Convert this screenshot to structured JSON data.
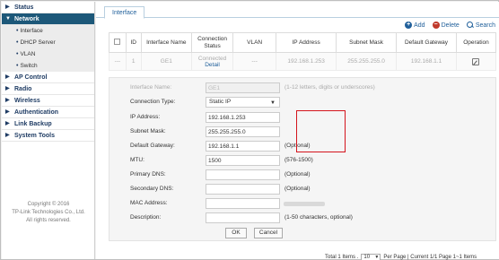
{
  "sidebar": {
    "items": [
      {
        "label": "Status"
      },
      {
        "label": "Network"
      },
      {
        "label": "AP Control"
      },
      {
        "label": "Radio"
      },
      {
        "label": "Wireless"
      },
      {
        "label": "Authentication"
      },
      {
        "label": "Link Backup"
      },
      {
        "label": "System Tools"
      }
    ],
    "subitems": [
      {
        "label": "Interface"
      },
      {
        "label": "DHCP Server"
      },
      {
        "label": "VLAN"
      },
      {
        "label": "Switch"
      }
    ],
    "copyright": [
      "Copyright © 2016",
      "TP-Link Technologies Co., Ltd.",
      "All rights reserved."
    ]
  },
  "tabs": [
    {
      "label": "Interface"
    }
  ],
  "toolbar": {
    "add": "Add",
    "delete": "Delete",
    "search": "Search"
  },
  "table": {
    "headers": [
      "ID",
      "Interface Name",
      "Connection Status",
      "VLAN",
      "IP Address",
      "Subnet Mask",
      "Default Gateway",
      "Operation"
    ],
    "rows": [
      {
        "id": "1",
        "name": "GE1",
        "status": "Connected",
        "detail": "Detail",
        "vlan": "---",
        "ip": "192.168.1.253",
        "mask": "255.255.255.0",
        "gateway": "192.168.1.1"
      }
    ]
  },
  "form": {
    "interface_name": {
      "label": "Interface Name:",
      "value": "GE1",
      "hint": "(1-12 letters, digits or underscores)"
    },
    "connection_type": {
      "label": "Connection Type:",
      "value": "Static IP"
    },
    "ip_address": {
      "label": "IP Address:",
      "value": "192.168.1.253"
    },
    "subnet_mask": {
      "label": "Subnet Mask:",
      "value": "255.255.255.0"
    },
    "default_gateway": {
      "label": "Default Gateway:",
      "value": "192.168.1.1",
      "hint": "(Optional)"
    },
    "mtu": {
      "label": "MTU:",
      "value": "1500",
      "hint": "(576-1500)"
    },
    "primary_dns": {
      "label": "Primary DNS:",
      "value": "",
      "hint": "(Optional)"
    },
    "secondary_dns": {
      "label": "Secondary DNS:",
      "value": "",
      "hint": "(Optional)"
    },
    "mac_address": {
      "label": "MAC Address:"
    },
    "description": {
      "label": "Description:",
      "value": "",
      "hint": "(1-50 characters, optional)"
    },
    "ok": "OK",
    "cancel": "Cancel"
  },
  "pager": {
    "total": "Total 1 Items .",
    "per_page_value": "10",
    "info": "Per Page | Current 1/1 Page 1~1 Items"
  },
  "colors": {
    "active_menu": "#1d5879",
    "link": "#1f5f9a",
    "highlight": "#d4141c",
    "delete": "#c0392b"
  }
}
